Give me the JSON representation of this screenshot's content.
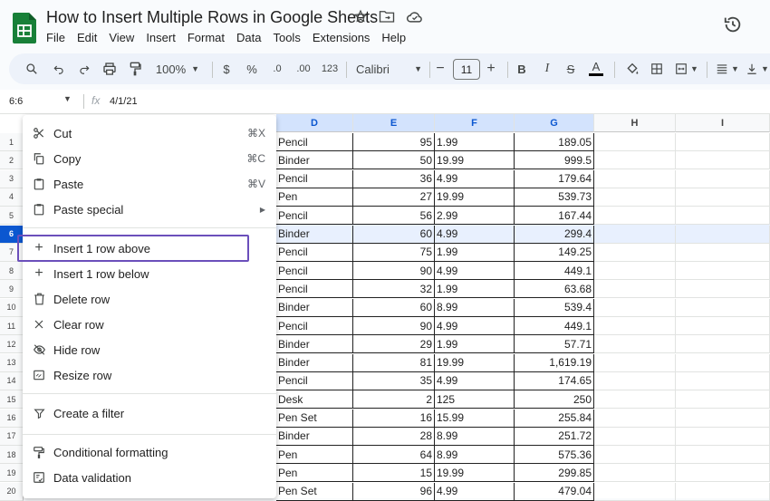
{
  "title": "How to Insert Multiple Rows in Google Sheets",
  "menus": [
    "File",
    "Edit",
    "View",
    "Insert",
    "Format",
    "Data",
    "Tools",
    "Extensions",
    "Help"
  ],
  "toolbar": {
    "zoom": "100%",
    "currency": "$",
    "percent": "%",
    "dec_decrease": ".0",
    "dec_increase": ".00",
    "number_format": "123",
    "font": "Calibri",
    "font_size": "11"
  },
  "formula_bar": {
    "cell_ref": "6:6",
    "fx": "fx",
    "value": "4/1/21"
  },
  "columns": [
    "D",
    "E",
    "F",
    "G",
    "H",
    "I"
  ],
  "rows": [
    {
      "n": "1",
      "d": "Pencil",
      "e": "95",
      "f": "1.99",
      "g": "189.05"
    },
    {
      "n": "2",
      "d": "Binder",
      "e": "50",
      "f": "19.99",
      "g": "999.5"
    },
    {
      "n": "3",
      "d": "Pencil",
      "e": "36",
      "f": "4.99",
      "g": "179.64"
    },
    {
      "n": "4",
      "d": "Pen",
      "e": "27",
      "f": "19.99",
      "g": "539.73"
    },
    {
      "n": "5",
      "d": "Pencil",
      "e": "56",
      "f": "2.99",
      "g": "167.44"
    },
    {
      "n": "6",
      "d": "Binder",
      "e": "60",
      "f": "4.99",
      "g": "299.4"
    },
    {
      "n": "7",
      "d": "Pencil",
      "e": "75",
      "f": "1.99",
      "g": "149.25"
    },
    {
      "n": "8",
      "d": "Pencil",
      "e": "90",
      "f": "4.99",
      "g": "449.1"
    },
    {
      "n": "9",
      "d": "Pencil",
      "e": "32",
      "f": "1.99",
      "g": "63.68"
    },
    {
      "n": "10",
      "d": "Binder",
      "e": "60",
      "f": "8.99",
      "g": "539.4"
    },
    {
      "n": "11",
      "d": "Pencil",
      "e": "90",
      "f": "4.99",
      "g": "449.1"
    },
    {
      "n": "12",
      "d": "Binder",
      "e": "29",
      "f": "1.99",
      "g": "57.71"
    },
    {
      "n": "13",
      "d": "Binder",
      "e": "81",
      "f": "19.99",
      "g": "1,619.19"
    },
    {
      "n": "14",
      "d": "Pencil",
      "e": "35",
      "f": "4.99",
      "g": "174.65"
    },
    {
      "n": "15",
      "d": "Desk",
      "e": "2",
      "f": "125",
      "g": "250"
    },
    {
      "n": "16",
      "d": "Pen Set",
      "e": "16",
      "f": "15.99",
      "g": "255.84"
    },
    {
      "n": "17",
      "d": "Binder",
      "e": "28",
      "f": "8.99",
      "g": "251.72"
    },
    {
      "n": "18",
      "d": "Pen",
      "e": "64",
      "f": "8.99",
      "g": "575.36"
    },
    {
      "n": "19",
      "d": "Pen",
      "e": "15",
      "f": "19.99",
      "g": "299.85"
    },
    {
      "n": "20",
      "d": "Pen Set",
      "e": "96",
      "f": "4.99",
      "g": "479.04"
    }
  ],
  "selected_row": "6",
  "context_menu": {
    "cut": "Cut",
    "cut_sc": "⌘X",
    "copy": "Copy",
    "copy_sc": "⌘C",
    "paste": "Paste",
    "paste_sc": "⌘V",
    "paste_special": "Paste special",
    "insert_above": "Insert 1 row above",
    "insert_below": "Insert 1 row below",
    "delete_row": "Delete row",
    "clear_row": "Clear row",
    "hide_row": "Hide row",
    "resize_row": "Resize row",
    "create_filter": "Create a filter",
    "conditional_formatting": "Conditional formatting",
    "data_validation": "Data validation"
  },
  "colors": {
    "accent": "#0b57d0",
    "highlight": "#6b4fbb",
    "logo": "#188038"
  }
}
